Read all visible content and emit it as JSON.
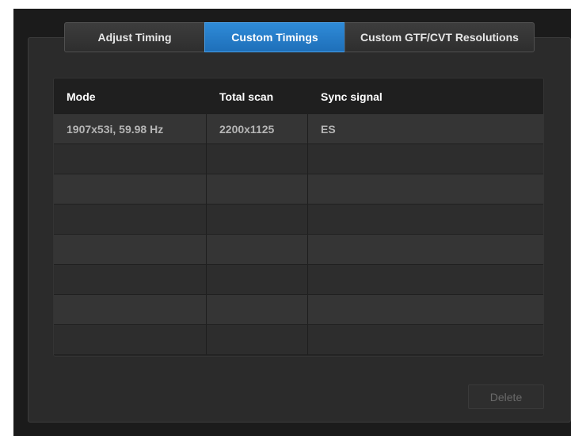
{
  "tabs": [
    {
      "label": "Adjust Timing"
    },
    {
      "label": "Custom Timings"
    },
    {
      "label": "Custom GTF/CVT Resolutions"
    }
  ],
  "active_tab": "Custom Timings",
  "table": {
    "headers": [
      "Mode",
      "Total scan",
      "Sync signal"
    ],
    "rows": [
      [
        "1907x53i, 59.98 Hz",
        "2200x1125",
        "ES"
      ],
      [
        "",
        "",
        ""
      ],
      [
        "",
        "",
        ""
      ],
      [
        "",
        "",
        ""
      ],
      [
        "",
        "",
        ""
      ],
      [
        "",
        "",
        ""
      ],
      [
        "",
        "",
        ""
      ],
      [
        "",
        "",
        ""
      ]
    ]
  },
  "buttons": {
    "delete_label": "Delete",
    "delete_enabled": false
  },
  "colors": {
    "active_tab": "#1e6fb9",
    "background": "#1b1b1b",
    "panel": "#2b2b2b"
  }
}
